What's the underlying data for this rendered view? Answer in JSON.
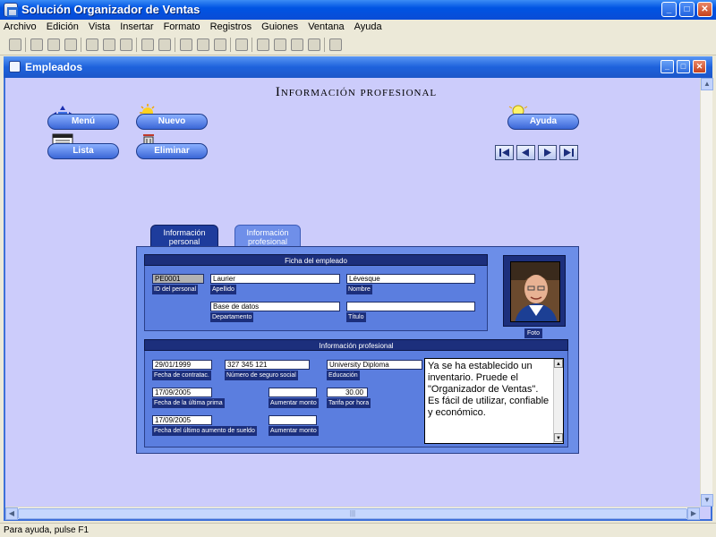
{
  "app": {
    "title": "Solución Organizador de Ventas"
  },
  "menu": [
    "Archivo",
    "Edición",
    "Vista",
    "Insertar",
    "Formato",
    "Registros",
    "Guiones",
    "Ventana",
    "Ayuda"
  ],
  "child_window": {
    "title": "Empleados"
  },
  "form": {
    "title": "Información profesional",
    "buttons": {
      "menu": "Menú",
      "nuevo": "Nuevo",
      "lista": "Lista",
      "eliminar": "Eliminar",
      "ayuda": "Ayuda"
    },
    "tabs": {
      "personal": [
        "Información",
        "personal"
      ],
      "profesional": [
        "Información",
        "profesional"
      ]
    },
    "ficha": {
      "header": "Ficha del empleado",
      "id_value": "PE0001",
      "id_label": "ID del personal",
      "apellido_value": "Laurier",
      "apellido_label": "Apellido",
      "nombre_value": "Lévesque",
      "nombre_label": "Nombre",
      "departamento_value": "Base de datos",
      "departamento_label": "Departamento",
      "titulo_value": "",
      "titulo_label": "Título",
      "foto_label": "Foto"
    },
    "profesional": {
      "header": "Información profesional",
      "fecha_contratacion_value": "29/01/1999",
      "fecha_contratacion_label": "Fecha de contratac.",
      "nss_value": "327 345 121",
      "nss_label": "Número de seguro social",
      "educacion_value": "University Diploma",
      "educacion_label": "Educación",
      "ultima_prima_value": "17/09/2005",
      "ultima_prima_label": "Fecha de la última prima",
      "aumentar_monto_1_value": "",
      "aumentar_monto_1_label": "Aumentar monto",
      "tarifa_value": "30.00",
      "tarifa_label": "Tarifa por hora",
      "ultimo_aumento_value": "17/09/2005",
      "ultimo_aumento_label": "Fecha del último aumento de sueldo",
      "aumentar_monto_2_value": "",
      "aumentar_monto_2_label": "Aumentar monto",
      "notes": "Ya se ha establecido un inventario. Pruede el \"Organizador de Ventas\". Es fácil de utilizar, confiable y económico."
    }
  },
  "status": {
    "text": "Para ayuda, pulse F1"
  },
  "colors": {
    "form_background": "#ccccfb",
    "panel": "#6c8ee8",
    "label_bg": "#1c2f7c",
    "title_bar": "#0054e3"
  }
}
